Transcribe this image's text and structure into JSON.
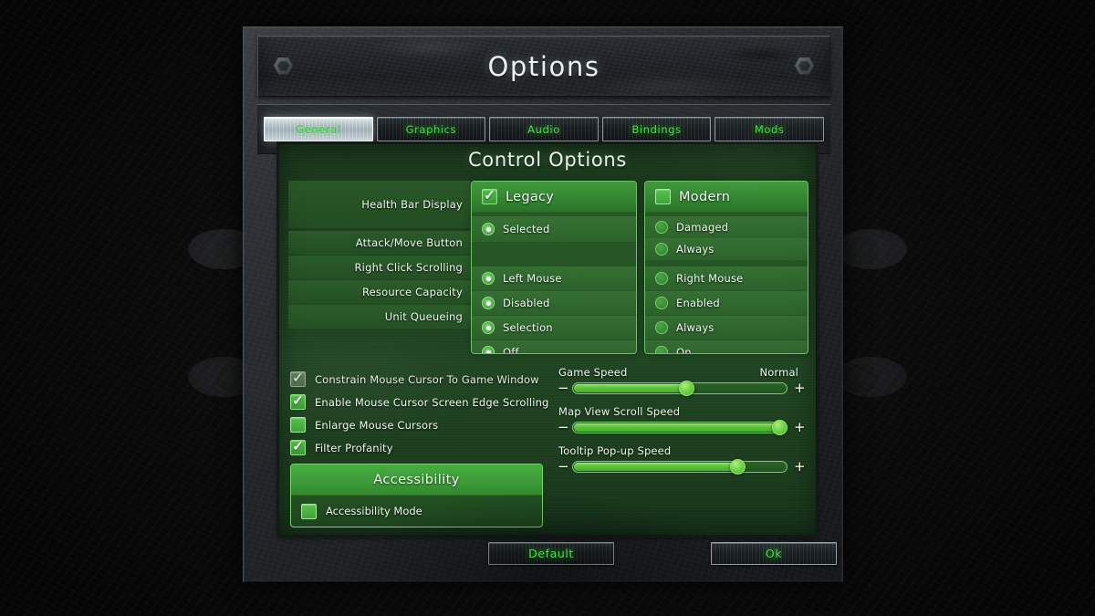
{
  "window": {
    "title": "Options"
  },
  "tabs": [
    {
      "label": "General",
      "active": true
    },
    {
      "label": "Graphics",
      "active": false
    },
    {
      "label": "Audio",
      "active": false
    },
    {
      "label": "Bindings",
      "active": false
    },
    {
      "label": "Mods",
      "active": false
    }
  ],
  "panel": {
    "title": "Control Options",
    "row_labels": [
      "Health Bar Display",
      "Attack/Move Button",
      "Right Click Scrolling",
      "Resource Capacity",
      "Unit Queueing"
    ],
    "columns": [
      {
        "header": "Legacy",
        "header_checked": true,
        "options": [
          {
            "label": "Selected",
            "selected": true
          },
          {
            "label": "Left Mouse",
            "selected": true
          },
          {
            "label": "Disabled",
            "selected": true
          },
          {
            "label": "Selection",
            "selected": true
          },
          {
            "label": "Off",
            "selected": true
          }
        ]
      },
      {
        "header": "Modern",
        "header_checked": false,
        "options": [
          {
            "label": "Damaged",
            "selected": false
          },
          {
            "label": "Always",
            "selected": false
          },
          {
            "label": "Right Mouse",
            "selected": false
          },
          {
            "label": "Enabled",
            "selected": false
          },
          {
            "label": "Always",
            "selected": false
          },
          {
            "label": "On",
            "selected": false
          }
        ]
      }
    ]
  },
  "checkboxes": [
    {
      "label": "Constrain Mouse Cursor To Game Window",
      "checked": true,
      "dimmed": true
    },
    {
      "label": "Enable Mouse Cursor Screen Edge Scrolling",
      "checked": true,
      "dimmed": false
    },
    {
      "label": "Enlarge Mouse Cursors",
      "checked": false,
      "dimmed": false
    },
    {
      "label": "Filter Profanity",
      "checked": true,
      "dimmed": false
    }
  ],
  "accessibility": {
    "header": "Accessibility",
    "mode_label": "Accessibility Mode",
    "mode_checked": false
  },
  "sliders": [
    {
      "name": "Game Speed",
      "value_label": "Normal",
      "percent": 53
    },
    {
      "name": "Map View Scroll Speed",
      "value_label": "",
      "percent": 97
    },
    {
      "name": "Tooltip Pop-up Speed",
      "value_label": "",
      "percent": 77
    }
  ],
  "footer": {
    "default_label": "Default",
    "ok_label": "Ok"
  },
  "colors": {
    "accent_green": "#4ce04c",
    "panel_green": "#204522",
    "slider_fill": "#5cc23c",
    "frame_steel": "#2a2e31"
  }
}
